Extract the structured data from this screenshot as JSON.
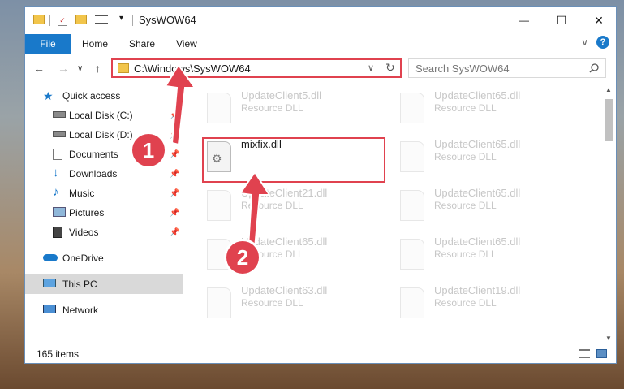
{
  "window": {
    "title": "SysWOW64",
    "minimize": "—",
    "maximize": "☐",
    "close": "✕"
  },
  "ribbon": {
    "file": "File",
    "home": "Home",
    "share": "Share",
    "view": "View",
    "expand": "∨",
    "help": "?"
  },
  "navbar": {
    "back": "←",
    "forward": "→",
    "recent": "∨",
    "up": "↑"
  },
  "address": {
    "path": "C:\\Windows\\SysWOW64",
    "dropdown": "∨",
    "refresh": "↻"
  },
  "search": {
    "placeholder": "Search SysWOW64"
  },
  "nav_pane": {
    "items": [
      {
        "label": "Quick access"
      },
      {
        "label": "Local Disk (C:)"
      },
      {
        "label": "Local Disk (D:)"
      },
      {
        "label": "Documents"
      },
      {
        "label": "Downloads"
      },
      {
        "label": "Music"
      },
      {
        "label": "Pictures"
      },
      {
        "label": "Videos"
      },
      {
        "label": "OneDrive"
      },
      {
        "label": "This PC"
      },
      {
        "label": "Network"
      }
    ]
  },
  "files": [
    {
      "name": "UpdateClient5.dll",
      "type": "Resource DLL"
    },
    {
      "name": "UpdateClient65.dll",
      "type": "Resource DLL"
    },
    {
      "name": "mixfix.dll",
      "type": ""
    },
    {
      "name": "UpdateClient65.dll",
      "type": "Resource DLL"
    },
    {
      "name": "UpdateClient21.dll",
      "type": "Resource DLL"
    },
    {
      "name": "UpdateClient65.dll",
      "type": "Resource DLL"
    },
    {
      "name": "UpdateClient65.dll",
      "type": "Resource DLL"
    },
    {
      "name": "UpdateClient65.dll",
      "type": "Resource DLL"
    },
    {
      "name": "UpdateClient63.dll",
      "type": "Resource DLL"
    },
    {
      "name": "UpdateClient19.dll",
      "type": "Resource DLL"
    }
  ],
  "status": {
    "count": "165 items"
  },
  "annotations": {
    "badge1": "1",
    "badge2": "2"
  },
  "colors": {
    "accent": "#1979ca",
    "highlight": "#e0424f",
    "selected_nav": "#cce4f7"
  }
}
